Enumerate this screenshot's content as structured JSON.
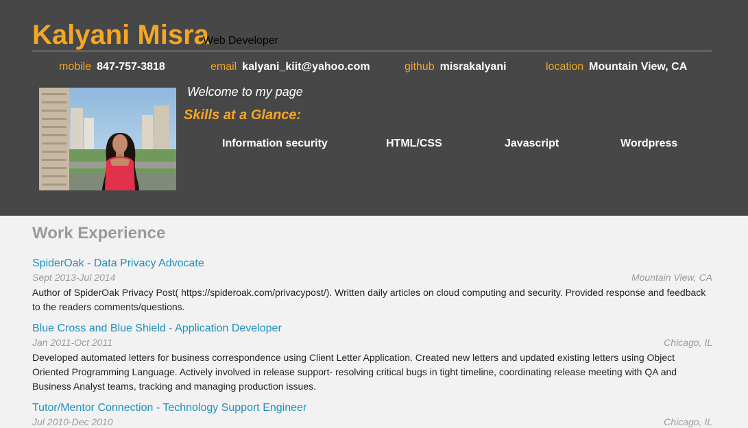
{
  "header": {
    "name": "Kalyani Misra",
    "role": "Web Developer",
    "contacts": [
      {
        "label": "mobile",
        "value": "847-757-3818"
      },
      {
        "label": "email",
        "value": "kalyani_kiit@yahoo.com"
      },
      {
        "label": "github",
        "value": "misrakalyani"
      },
      {
        "label": "location",
        "value": "Mountain View, CA"
      }
    ],
    "welcome": "Welcome to my page",
    "skills_title": "Skills at a Glance:",
    "skills": [
      "Information security",
      "HTML/CSS",
      "Javascript",
      "Wordpress"
    ]
  },
  "work": {
    "title": "Work Experience",
    "jobs": [
      {
        "title": "SpiderOak - Data Privacy Advocate",
        "dates": "Sept 2013-Jul 2014",
        "location": "Mountain View, CA",
        "description": "Author of SpiderOak Privacy Post( https://spideroak.com/privacypost/). Written daily articles on cloud computing and security. Provided response and feedback to the readers comments/questions."
      },
      {
        "title": "Blue Cross and Blue Shield - Application Developer",
        "dates": "Jan 2011-Oct 2011",
        "location": "Chicago, IL",
        "description": "Developed automated letters for business correspondence using Client Letter Application. Created new letters and updated existing letters using Object Oriented Programming Language. Actively involved in release support- resolving critical bugs in tight timeline, coordinating release meeting with QA and Business Analyst teams, tracking and managing production issues."
      },
      {
        "title": "Tutor/Mentor Connection - Technology Support Engineer",
        "dates": "Jul 2010-Dec 2010",
        "location": "Chicago, IL",
        "description": ""
      }
    ]
  },
  "colors": {
    "header_bg": "#474747",
    "accent": "#f5a623",
    "link": "#1e8fbf",
    "muted": "#9a9a9a",
    "page_bg": "#f2f2f2"
  }
}
